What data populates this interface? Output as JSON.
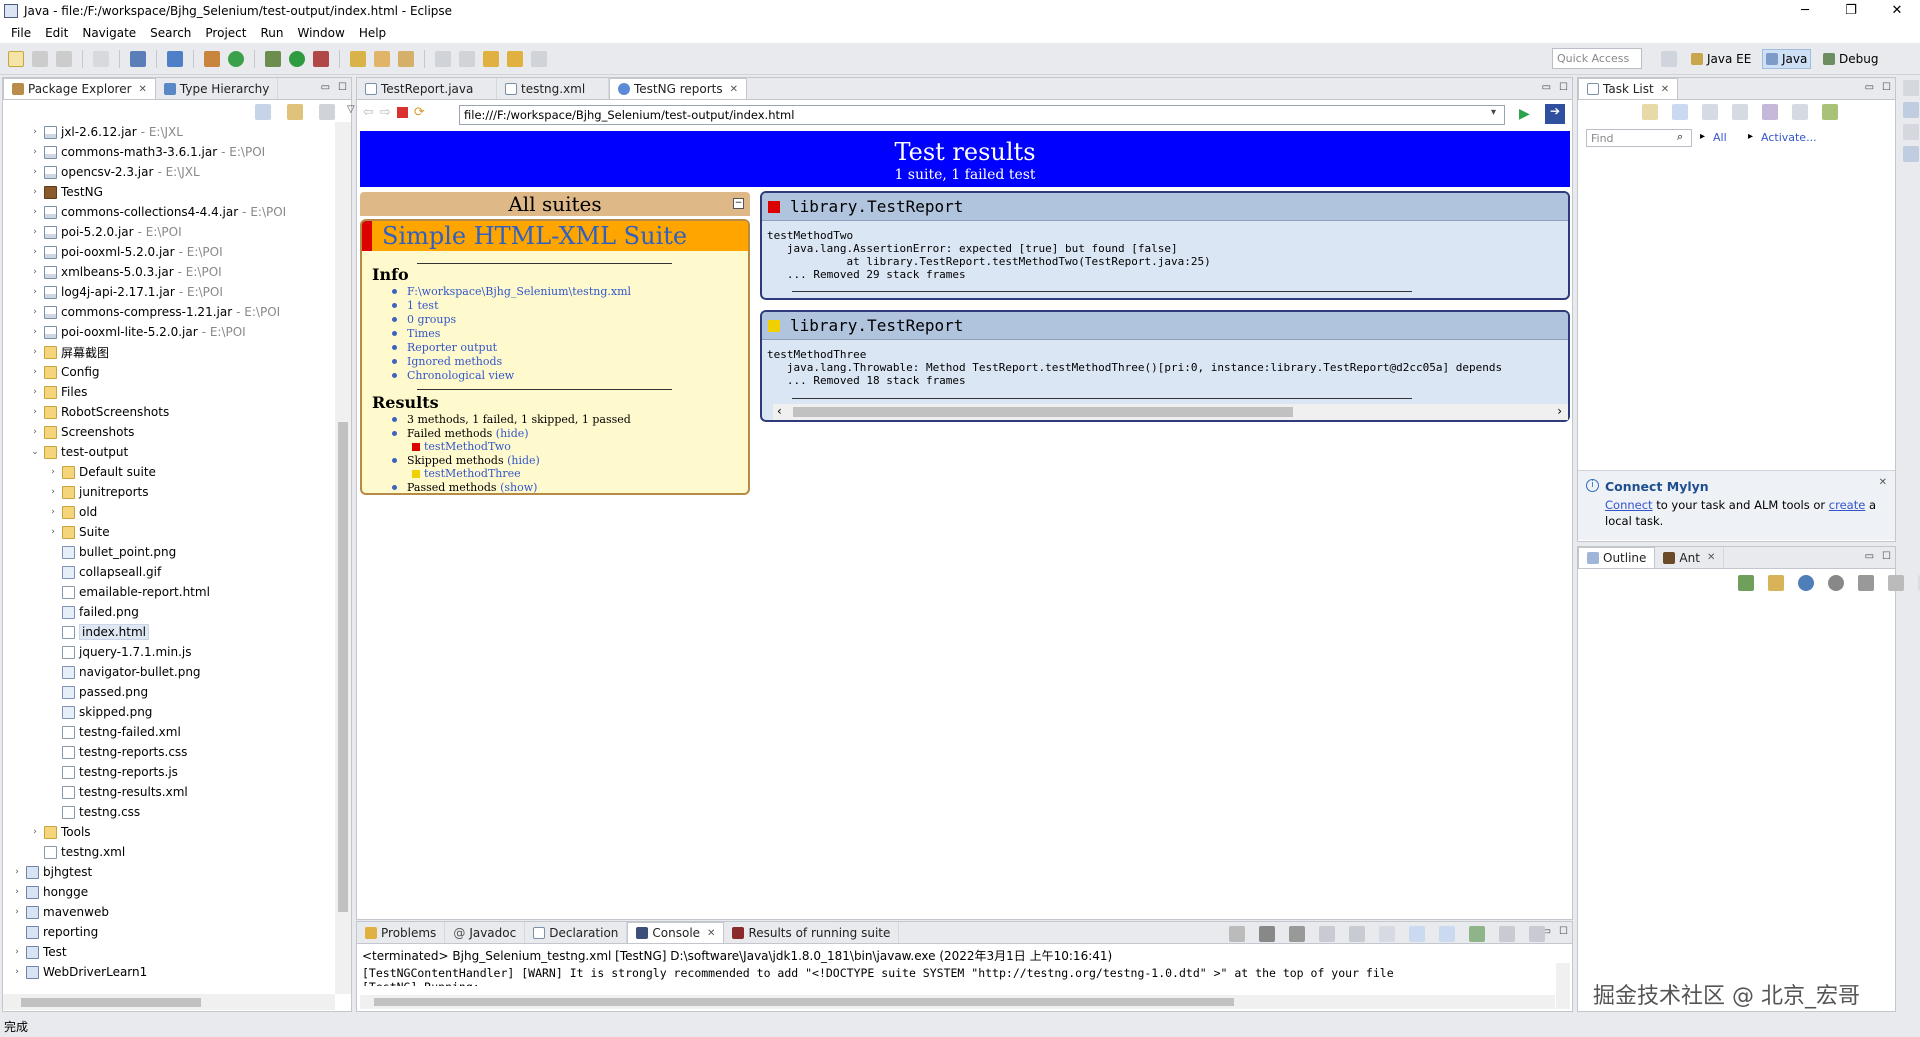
{
  "window": {
    "title": "Java - file:/F:/workspace/Bjhg_Selenium/test-output/index.html - Eclipse",
    "min_glyph": "─",
    "max_glyph": "❐",
    "close_glyph": "✕"
  },
  "menu": [
    "File",
    "Edit",
    "Navigate",
    "Search",
    "Project",
    "Run",
    "Window",
    "Help"
  ],
  "toolbar": {
    "quick_access_placeholder": "Quick Access",
    "perspectives": [
      "Java EE",
      "Java",
      "Debug"
    ]
  },
  "package_explorer": {
    "tabs": [
      "Package Explorer",
      "Type Hierarchy"
    ],
    "tree": [
      {
        "label": "jxl-2.6.12.jar",
        "loc": "- E:\\JXL",
        "icon": "jar",
        "depth": 1,
        "twist": ">"
      },
      {
        "label": "commons-math3-3.6.1.jar",
        "loc": "- E:\\POI",
        "icon": "jar",
        "depth": 1,
        "twist": ">"
      },
      {
        "label": "opencsv-2.3.jar",
        "loc": "- E:\\JXL",
        "icon": "jar",
        "depth": 1,
        "twist": ">"
      },
      {
        "label": "TestNG",
        "loc": "",
        "icon": "tng",
        "depth": 1,
        "twist": ">"
      },
      {
        "label": "commons-collections4-4.4.jar",
        "loc": "- E:\\POI",
        "icon": "jar",
        "depth": 1,
        "twist": ">"
      },
      {
        "label": "poi-5.2.0.jar",
        "loc": "- E:\\POI",
        "icon": "jar",
        "depth": 1,
        "twist": ">"
      },
      {
        "label": "poi-ooxml-5.2.0.jar",
        "loc": "- E:\\POI",
        "icon": "jar",
        "depth": 1,
        "twist": ">"
      },
      {
        "label": "xmlbeans-5.0.3.jar",
        "loc": "- E:\\POI",
        "icon": "jar",
        "depth": 1,
        "twist": ">"
      },
      {
        "label": "log4j-api-2.17.1.jar",
        "loc": "- E:\\POI",
        "icon": "jar",
        "depth": 1,
        "twist": ">"
      },
      {
        "label": "commons-compress-1.21.jar",
        "loc": "- E:\\POI",
        "icon": "jar",
        "depth": 1,
        "twist": ">"
      },
      {
        "label": "poi-ooxml-lite-5.2.0.jar",
        "loc": "- E:\\POI",
        "icon": "jar",
        "depth": 1,
        "twist": ">"
      },
      {
        "label": "屏幕截图",
        "loc": "",
        "icon": "folder",
        "depth": 1,
        "twist": ">"
      },
      {
        "label": "Config",
        "loc": "",
        "icon": "folder",
        "depth": 1,
        "twist": ">"
      },
      {
        "label": "Files",
        "loc": "",
        "icon": "folder",
        "depth": 1,
        "twist": ">"
      },
      {
        "label": "RobotScreenshots",
        "loc": "",
        "icon": "folder",
        "depth": 1,
        "twist": ">"
      },
      {
        "label": "Screenshots",
        "loc": "",
        "icon": "folder",
        "depth": 1,
        "twist": ">"
      },
      {
        "label": "test-output",
        "loc": "",
        "icon": "folder",
        "depth": 1,
        "twist": "v"
      },
      {
        "label": "Default suite",
        "loc": "",
        "icon": "folder",
        "depth": 2,
        "twist": ">"
      },
      {
        "label": "junitreports",
        "loc": "",
        "icon": "folder",
        "depth": 2,
        "twist": ">"
      },
      {
        "label": "old",
        "loc": "",
        "icon": "folder",
        "depth": 2,
        "twist": ">"
      },
      {
        "label": "Suite",
        "loc": "",
        "icon": "folder",
        "depth": 2,
        "twist": ">"
      },
      {
        "label": "bullet_point.png",
        "loc": "",
        "icon": "img",
        "depth": 2,
        "twist": ""
      },
      {
        "label": "collapseall.gif",
        "loc": "",
        "icon": "img",
        "depth": 2,
        "twist": ""
      },
      {
        "label": "emailable-report.html",
        "loc": "",
        "icon": "file",
        "depth": 2,
        "twist": ""
      },
      {
        "label": "failed.png",
        "loc": "",
        "icon": "img",
        "depth": 2,
        "twist": ""
      },
      {
        "label": "index.html",
        "loc": "",
        "icon": "file",
        "depth": 2,
        "twist": "",
        "selected": true
      },
      {
        "label": "jquery-1.7.1.min.js",
        "loc": "",
        "icon": "file",
        "depth": 2,
        "twist": ""
      },
      {
        "label": "navigator-bullet.png",
        "loc": "",
        "icon": "img",
        "depth": 2,
        "twist": ""
      },
      {
        "label": "passed.png",
        "loc": "",
        "icon": "img",
        "depth": 2,
        "twist": ""
      },
      {
        "label": "skipped.png",
        "loc": "",
        "icon": "img",
        "depth": 2,
        "twist": ""
      },
      {
        "label": "testng-failed.xml",
        "loc": "",
        "icon": "file",
        "depth": 2,
        "twist": ""
      },
      {
        "label": "testng-reports.css",
        "loc": "",
        "icon": "file",
        "depth": 2,
        "twist": ""
      },
      {
        "label": "testng-reports.js",
        "loc": "",
        "icon": "file",
        "depth": 2,
        "twist": ""
      },
      {
        "label": "testng-results.xml",
        "loc": "",
        "icon": "file",
        "depth": 2,
        "twist": ""
      },
      {
        "label": "testng.css",
        "loc": "",
        "icon": "file",
        "depth": 2,
        "twist": ""
      },
      {
        "label": "Tools",
        "loc": "",
        "icon": "folder",
        "depth": 1,
        "twist": ">"
      },
      {
        "label": "testng.xml",
        "loc": "",
        "icon": "file",
        "depth": 1,
        "twist": ""
      },
      {
        "label": "bjhgtest",
        "loc": "",
        "icon": "proj",
        "depth": 0,
        "twist": ">"
      },
      {
        "label": "hongge",
        "loc": "",
        "icon": "proj",
        "depth": 0,
        "twist": ">"
      },
      {
        "label": "mavenweb",
        "loc": "",
        "icon": "proj",
        "depth": 0,
        "twist": ">"
      },
      {
        "label": "reporting",
        "loc": "",
        "icon": "proj",
        "depth": 0,
        "twist": ""
      },
      {
        "label": "Test",
        "loc": "",
        "icon": "proj",
        "depth": 0,
        "twist": ">"
      },
      {
        "label": "WebDriverLearn1",
        "loc": "",
        "icon": "proj",
        "depth": 0,
        "twist": ">"
      }
    ]
  },
  "editor": {
    "tabs": [
      "TestReport.java",
      "testng.xml",
      "TestNG reports"
    ],
    "url": "file:///F:/workspace/Bjhg_Selenium/test-output/index.html"
  },
  "report": {
    "title": "Test results",
    "subtitle": "1 suite, 1 failed test",
    "all_suites": "All suites",
    "suite_name": "Simple HTML-XML Suite",
    "info_heading": "Info",
    "info_items": [
      "F:\\workspace\\Bjhg_Selenium\\testng.xml",
      "1 test",
      "0 groups",
      "Times",
      "Reporter output",
      "Ignored methods",
      "Chronological view"
    ],
    "results_heading": "Results",
    "summary": "3 methods, 1 failed, 1 skipped, 1 passed",
    "failed_label": "Failed methods",
    "failed_toggle": "(hide)",
    "failed_method": "testMethodTwo",
    "skipped_label": "Skipped methods",
    "skipped_toggle": "(hide)",
    "skipped_method": "testMethodThree",
    "passed_label": "Passed methods",
    "passed_toggle": "(show)",
    "results": [
      {
        "class": "library.TestReport",
        "status": "failed",
        "body": "testMethodTwo\n   java.lang.AssertionError: expected [true] but found [false]\n            at library.TestReport.testMethodTwo(TestReport.java:25)\n   ... Removed 29 stack frames"
      },
      {
        "class": "library.TestReport",
        "status": "skipped",
        "body": "testMethodThree\n   java.lang.Throwable: Method TestReport.testMethodThree()[pri:0, instance:library.TestReport@d2cc05a] depends\n   ... Removed 18 stack frames"
      }
    ]
  },
  "task_list": {
    "tab": "Task List",
    "find_placeholder": "Find",
    "all_label": "All",
    "activate_label": "Activate..."
  },
  "mylyn": {
    "title": "Connect Mylyn",
    "text_connect": "Connect",
    "text_mid": " to your task and ALM tools or ",
    "text_create": "create",
    "text_end": " a local task."
  },
  "outline": {
    "tabs": [
      "Outline",
      "Ant"
    ]
  },
  "console": {
    "tabs": [
      "Problems",
      "Javadoc",
      "Declaration",
      "Console",
      "Results of running suite"
    ],
    "header": "<terminated> Bjhg_Selenium_testng.xml [TestNG] D:\\software\\Java\\jdk1.8.0_181\\bin\\javaw.exe (2022年3月1日 上午10:16:41)",
    "line1": "[TestNGContentHandler] [WARN] It is strongly recommended to add \"<!DOCTYPE suite SYSTEM \"http://testng.org/testng-1.0.dtd\" >\" at the top of your file",
    "line2": "[TestNG] Running:"
  },
  "status": {
    "text": "完成"
  },
  "watermark": "掘金技术社区 @ 北京_宏哥",
  "colors": {
    "report_header": "#0000ff",
    "suite_header": "#ffa500",
    "failed": "#dd0000",
    "skipped": "#f0d000"
  }
}
